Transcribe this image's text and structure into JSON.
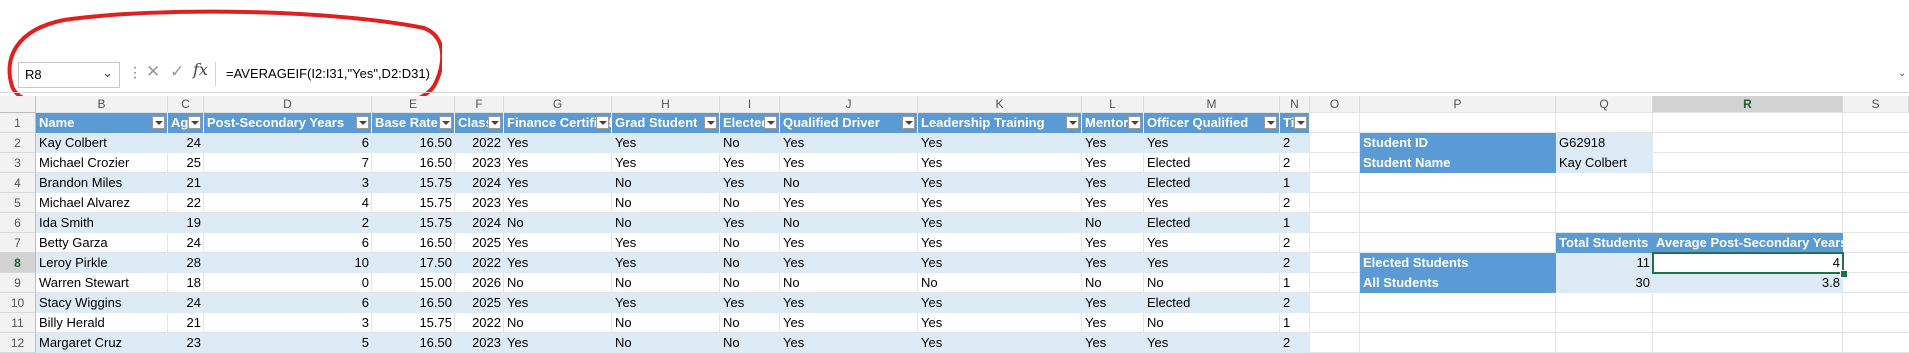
{
  "formula_bar": {
    "name_box": "R8",
    "formula": "=AVERAGEIF(I2:I31,\"Yes\",D2:D31)"
  },
  "columns": [
    "B",
    "C",
    "D",
    "E",
    "F",
    "G",
    "H",
    "I",
    "J",
    "K",
    "L",
    "M",
    "N",
    "O",
    "P",
    "Q",
    "R",
    "S"
  ],
  "rows": [
    "1",
    "2",
    "3",
    "4",
    "5",
    "6",
    "7",
    "8",
    "9",
    "10",
    "11",
    "12"
  ],
  "selected": {
    "row": "8",
    "column": "R"
  },
  "table": {
    "headers": [
      "Name",
      "Age",
      "Post-Secondary Years",
      "Base Rate",
      "Class",
      "Finance Certified",
      "Grad Student",
      "Elected",
      "Qualified Driver",
      "Leadership Training",
      "Mentor",
      "Officer Qualified",
      "Tier"
    ],
    "rows": [
      [
        "Kay Colbert",
        "24",
        "6",
        "16.50",
        "2022",
        "Yes",
        "Yes",
        "No",
        "Yes",
        "Yes",
        "Yes",
        "Yes",
        "2"
      ],
      [
        "Michael Crozier",
        "25",
        "7",
        "16.50",
        "2023",
        "Yes",
        "Yes",
        "Yes",
        "Yes",
        "Yes",
        "Yes",
        "Elected",
        "2"
      ],
      [
        "Brandon Miles",
        "21",
        "3",
        "15.75",
        "2024",
        "Yes",
        "No",
        "Yes",
        "No",
        "Yes",
        "Yes",
        "Elected",
        "1"
      ],
      [
        "Michael Alvarez",
        "22",
        "4",
        "15.75",
        "2023",
        "Yes",
        "No",
        "No",
        "Yes",
        "Yes",
        "Yes",
        "Yes",
        "2"
      ],
      [
        "Ida Smith",
        "19",
        "2",
        "15.75",
        "2024",
        "No",
        "No",
        "Yes",
        "No",
        "Yes",
        "No",
        "Elected",
        "1"
      ],
      [
        "Betty Garza",
        "24",
        "6",
        "16.50",
        "2025",
        "Yes",
        "Yes",
        "No",
        "Yes",
        "Yes",
        "Yes",
        "Yes",
        "2"
      ],
      [
        "Leroy Pirkle",
        "28",
        "10",
        "17.50",
        "2022",
        "Yes",
        "Yes",
        "No",
        "Yes",
        "Yes",
        "Yes",
        "Yes",
        "2"
      ],
      [
        "Warren Stewart",
        "18",
        "0",
        "15.00",
        "2026",
        "No",
        "No",
        "No",
        "No",
        "No",
        "No",
        "No",
        "1"
      ],
      [
        "Stacy Wiggins",
        "24",
        "6",
        "16.50",
        "2025",
        "Yes",
        "Yes",
        "Yes",
        "Yes",
        "Yes",
        "Yes",
        "Elected",
        "2"
      ],
      [
        "Billy Herald",
        "21",
        "3",
        "15.75",
        "2022",
        "No",
        "No",
        "No",
        "Yes",
        "Yes",
        "Yes",
        "No",
        "1"
      ],
      [
        "Margaret Cruz",
        "23",
        "5",
        "16.50",
        "2023",
        "Yes",
        "No",
        "No",
        "Yes",
        "Yes",
        "Yes",
        "Yes",
        "2"
      ]
    ]
  },
  "lookup": {
    "student_id_label": "Student ID",
    "student_id_value": "G62918",
    "student_name_label": "Student Name",
    "student_name_value": "Kay Colbert"
  },
  "summary": {
    "header_total": "Total Students",
    "header_avg": "Average Post-Secondary Years",
    "elected_label": "Elected Students",
    "elected_total": "11",
    "elected_avg": "4",
    "all_label": "All Students",
    "all_total": "30",
    "all_avg": "3.8"
  },
  "colors": {
    "header_blue": "#5b9bd5",
    "band_blue": "#ddebf7",
    "selection_green": "#217346",
    "annotation_red": "#e0201f"
  }
}
